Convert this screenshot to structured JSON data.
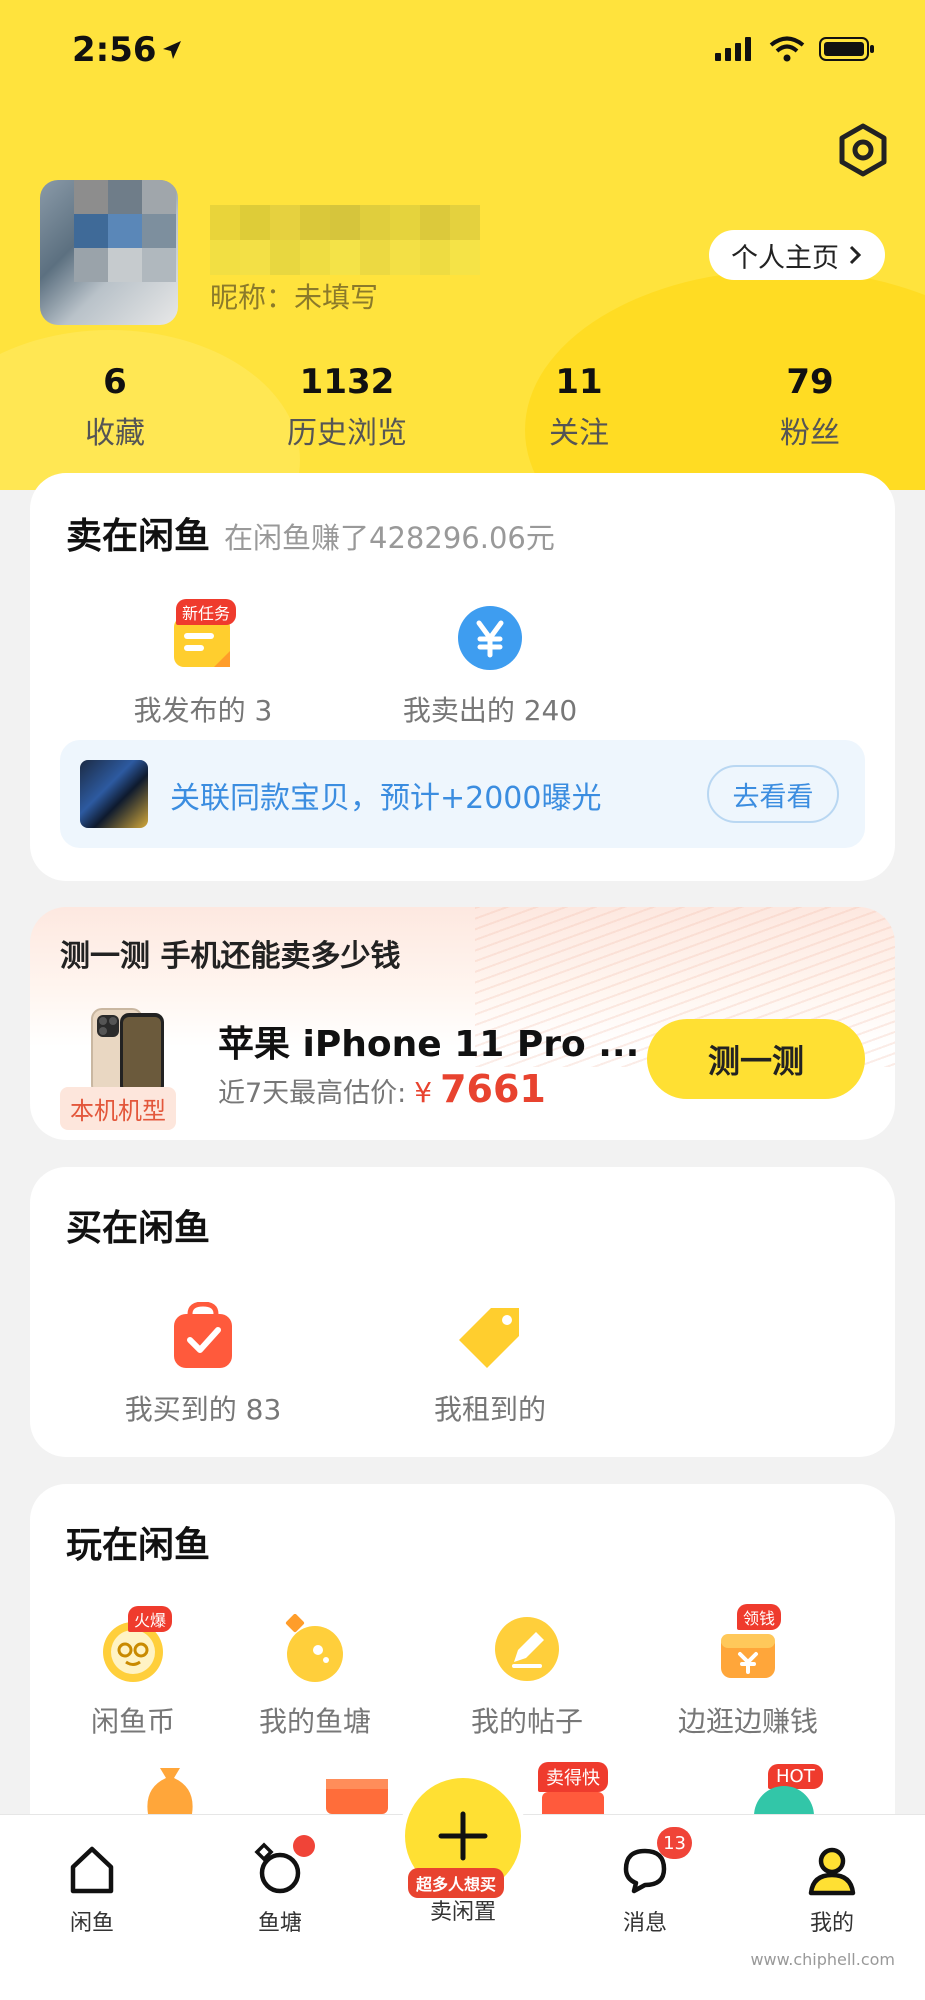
{
  "status_bar": {
    "time": "2:56"
  },
  "profile": {
    "nickname_line": "昵称：未填写",
    "home_button": "个人主页",
    "stats": [
      {
        "value": "6",
        "label": "收藏"
      },
      {
        "value": "1132",
        "label": "历史浏览"
      },
      {
        "value": "11",
        "label": "关注"
      },
      {
        "value": "79",
        "label": "粉丝"
      }
    ]
  },
  "sell_section": {
    "title": "卖在闲鱼",
    "subtitle": "在闲鱼赚了428296.06元",
    "items": [
      {
        "label": "我发布的 3",
        "tag": "新任务",
        "icon": "new-task-icon"
      },
      {
        "label": "我卖出的 240",
        "icon": "yen-coin-icon"
      }
    ],
    "promo": {
      "text": "关联同款宝贝，预计+2000曝光",
      "button": "去看看"
    }
  },
  "price_test": {
    "headline": "测一测 手机还能卖多少钱",
    "model": "苹果 iPhone 11 Pro ...",
    "device_tag": "本机机型",
    "estimate_label": "近7天最高估价:",
    "currency": "¥",
    "price": "7661",
    "button": "测一测"
  },
  "buy_section": {
    "title": "买在闲鱼",
    "items": [
      {
        "label": "我买到的 83",
        "icon": "shopping-bag-icon"
      },
      {
        "label": "我租到的",
        "icon": "price-tag-icon"
      }
    ]
  },
  "play_section": {
    "title": "玩在闲鱼",
    "items": [
      {
        "label": "闲鱼币",
        "tag": "火爆",
        "icon": "fish-coin-icon"
      },
      {
        "label": "我的鱼塘",
        "icon": "fish-pond-icon"
      },
      {
        "label": "我的帖子",
        "icon": "post-edit-icon"
      },
      {
        "label": "边逛边赚钱",
        "tag": "领钱",
        "icon": "money-box-icon"
      }
    ],
    "more_tags": [
      "卖得快",
      "HOT"
    ]
  },
  "bottom_nav": {
    "tabs": [
      {
        "label": "闲鱼",
        "icon": "home-icon"
      },
      {
        "label": "鱼塘",
        "icon": "pond-icon"
      },
      {
        "label": "卖闲置",
        "icon": "plus-icon",
        "tag": "超多人想买"
      },
      {
        "label": "消息",
        "icon": "chat-icon",
        "badge": "13"
      },
      {
        "label": "我的",
        "icon": "person-icon"
      }
    ]
  },
  "watermark": "www.chiphell.com",
  "colors": {
    "brand_yellow": "#ffe33d",
    "accent_red": "#e8432f",
    "link_blue": "#3b8de0"
  }
}
